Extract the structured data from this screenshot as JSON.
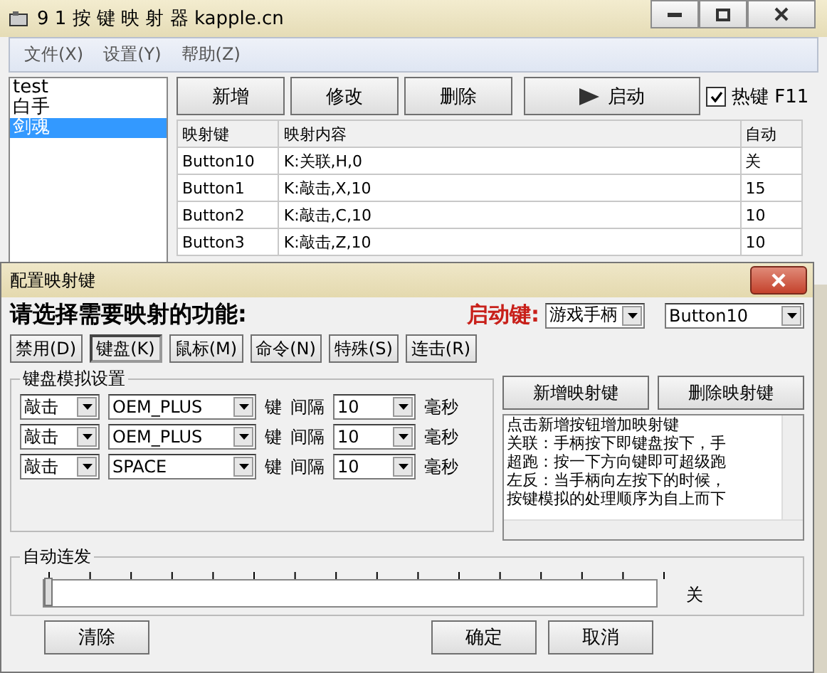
{
  "window": {
    "title": "9 1 按 键 映 射 器  kapple.cn"
  },
  "menu": [
    "文件(X)",
    "设置(Y)",
    "帮助(Z)"
  ],
  "profiles": [
    {
      "label": "test",
      "selected": false
    },
    {
      "label": "白手",
      "selected": false
    },
    {
      "label": "剑魂",
      "selected": true
    }
  ],
  "toolbar": {
    "buttons": [
      "新增",
      "修改",
      "删除"
    ],
    "start": "启动",
    "hotkey": {
      "label": "热键 F11",
      "checked": true
    }
  },
  "table": {
    "columns": [
      "映射键",
      "映射内容",
      "自动"
    ],
    "rows": [
      [
        "Button10",
        "K:关联,H,0",
        "关"
      ],
      [
        "Button1",
        "K:敲击,X,10",
        "15"
      ],
      [
        "Button2",
        "K:敲击,C,10",
        "10"
      ],
      [
        "Button3",
        "K:敲击,Z,10",
        "10"
      ]
    ]
  },
  "dialog": {
    "title": "配置映射键",
    "prompt": "请选择需要映射的功能:",
    "start_key_label": "启动键:",
    "device": "游戏手柄",
    "button": "Button10",
    "tabs": [
      {
        "label": "禁用(D)",
        "selected": false
      },
      {
        "label": "键盘(K)",
        "selected": true
      },
      {
        "label": "鼠标(M)",
        "selected": false
      },
      {
        "label": "命令(N)",
        "selected": false
      },
      {
        "label": "特殊(S)",
        "selected": false
      },
      {
        "label": "连击(R)",
        "selected": false
      }
    ],
    "group": "键盘模拟设置",
    "mappings": [
      {
        "mode": "敲击",
        "key": "OEM_PLUS",
        "key_label": "键",
        "interval_label": "间隔",
        "interval": "10",
        "unit": "毫秒"
      },
      {
        "mode": "敲击",
        "key": "OEM_PLUS",
        "key_label": "键",
        "interval_label": "间隔",
        "interval": "10",
        "unit": "毫秒"
      },
      {
        "mode": "敲击",
        "key": "SPACE",
        "key_label": "键",
        "interval_label": "间隔",
        "interval": "10",
        "unit": "毫秒"
      }
    ],
    "add_button": "新增映射键",
    "remove_button": "删除映射键",
    "help_lines": [
      "点击新增按钮增加映射键",
      "关联：手柄按下即键盘按下，手",
      "超跑：按一下方向键即可超级跑",
      "左反：当手柄向左按下的时候，",
      "按键模拟的处理顺序为自上而下"
    ],
    "autofire": {
      "label": "自动连发",
      "level": 0,
      "reading": "关"
    },
    "buttons": {
      "clear": "清除",
      "ok": "确定",
      "cancel": "取消"
    }
  }
}
